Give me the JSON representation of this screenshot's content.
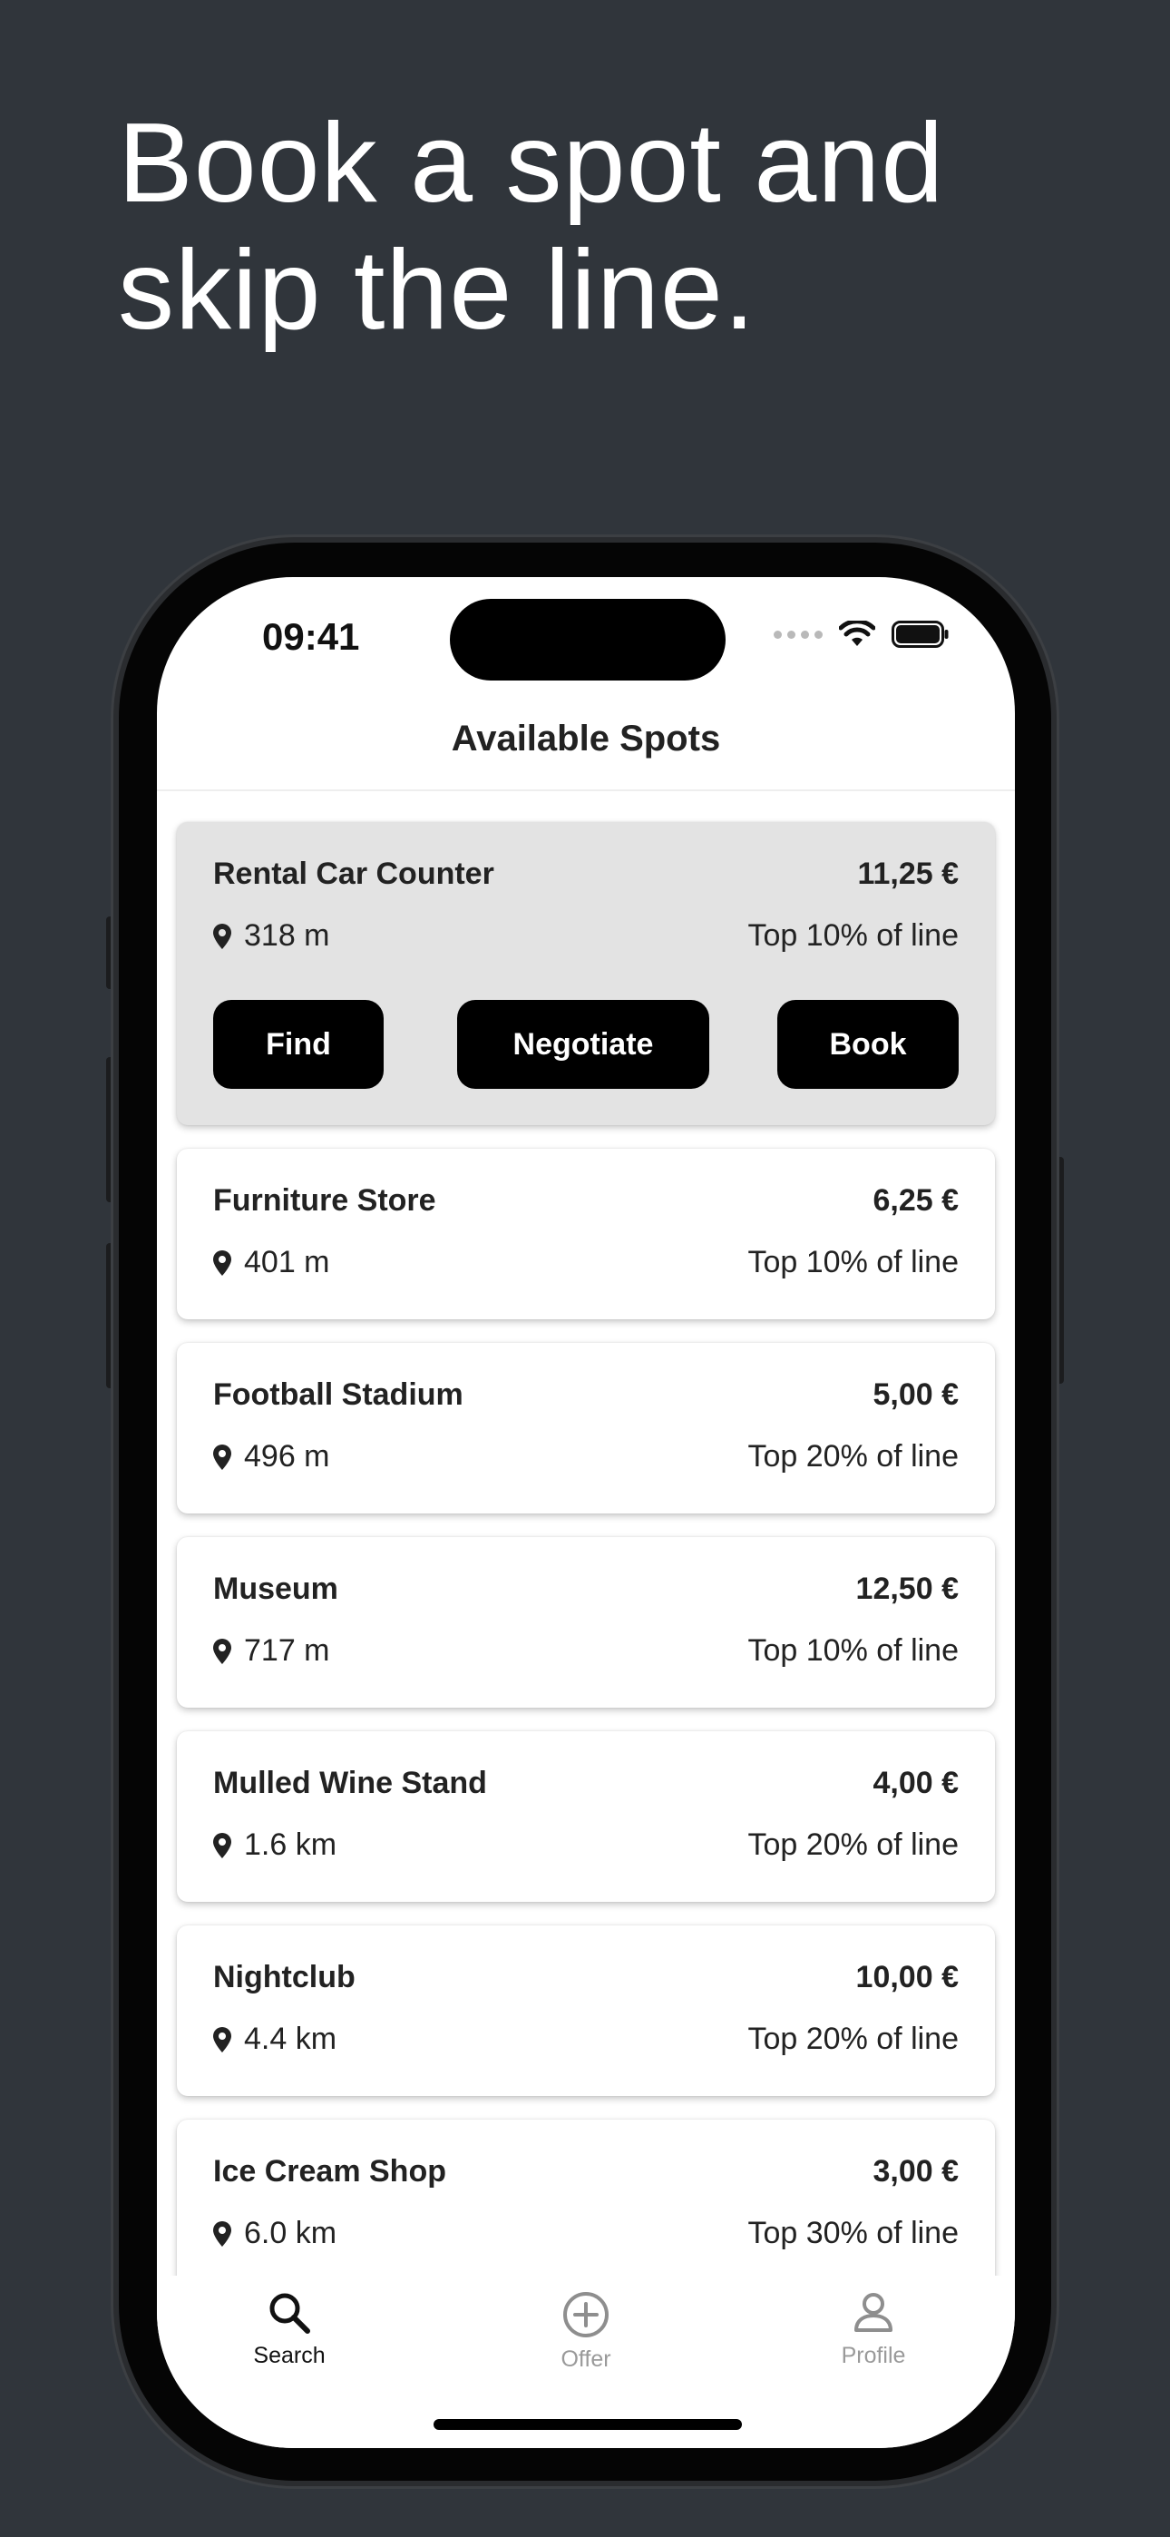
{
  "headline": {
    "line1": "Book a spot and",
    "line2": "skip the line."
  },
  "status_bar": {
    "time": "09:41"
  },
  "nav": {
    "title": "Available Spots"
  },
  "spots": [
    {
      "name": "Rental Car Counter",
      "price": "11,25 €",
      "distance": "318 m",
      "line_position": "Top 10% of line",
      "expanded": true
    },
    {
      "name": "Furniture Store",
      "price": "6,25 €",
      "distance": "401 m",
      "line_position": "Top 10% of line"
    },
    {
      "name": "Football Stadium",
      "price": "5,00 €",
      "distance": "496 m",
      "line_position": "Top 20% of line"
    },
    {
      "name": "Museum",
      "price": "12,50 €",
      "distance": "717 m",
      "line_position": "Top 10% of line"
    },
    {
      "name": "Mulled Wine Stand",
      "price": "4,00 €",
      "distance": "1.6 km",
      "line_position": "Top 20% of line"
    },
    {
      "name": "Nightclub",
      "price": "10,00 €",
      "distance": "4.4 km",
      "line_position": "Top 20% of line"
    },
    {
      "name": "Ice Cream Shop",
      "price": "3,00 €",
      "distance": "6.0 km",
      "line_position": "Top 30% of line"
    }
  ],
  "actions": {
    "find": "Find",
    "negotiate": "Negotiate",
    "book": "Book"
  },
  "tabs": [
    {
      "label": "Search",
      "icon": "search-icon",
      "active": true
    },
    {
      "label": "Offer",
      "icon": "plus-circle-icon",
      "active": false
    },
    {
      "label": "Profile",
      "icon": "person-icon",
      "active": false
    }
  ],
  "colors": {
    "background": "#30353b",
    "button": "#000000",
    "expanded_card": "#e3e3e3"
  }
}
